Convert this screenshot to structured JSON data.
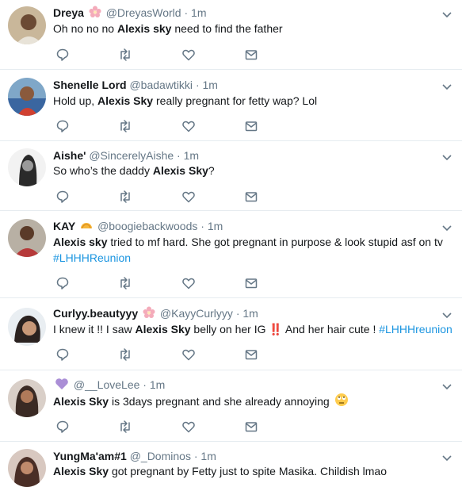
{
  "colors": {
    "accent": "#1b95e0",
    "muted": "#657786",
    "border": "#e6ecf0",
    "text": "#14171a"
  },
  "tweets": [
    {
      "name": "Dreya",
      "name_emoji": "cherry-blossom-icon",
      "handle": "@DreyasWorld",
      "time": "1m",
      "parts": [
        {
          "t": "Oh no no no "
        },
        {
          "t": "Alexis sky",
          "b": true
        },
        {
          "t": " need to find the father"
        }
      ]
    },
    {
      "name": "Shenelle Lord",
      "handle": "@badawtikki",
      "time": "1m",
      "parts": [
        {
          "t": "Hold up, "
        },
        {
          "t": "Alexis Sky",
          "b": true
        },
        {
          "t": " really pregnant for fetty wap? Lol"
        }
      ]
    },
    {
      "name": "Aishe'",
      "handle": "@SincerelyAishe",
      "time": "1m",
      "parts": [
        {
          "t": "So who’s the daddy "
        },
        {
          "t": "Alexis Sky",
          "b": true
        },
        {
          "t": "?"
        }
      ]
    },
    {
      "name": "KAY",
      "name_emoji": "taco-icon",
      "handle": "@boogiebackwoods",
      "time": "1m",
      "parts": [
        {
          "t": "Alexis sky",
          "b": true
        },
        {
          "t": " tried to mf hard. She got pregnant in purpose & look stupid asf on tv"
        },
        {
          "t": "\n"
        },
        {
          "t": "#LHHHReunion",
          "h": true
        }
      ]
    },
    {
      "name": "Curlyy.beautyyy",
      "name_emoji": "cherry-blossom-icon",
      "handle": "@KayyCurlyyy",
      "time": "1m",
      "parts": [
        {
          "t": "I knew it !! I saw "
        },
        {
          "t": "Alexis Sky",
          "b": true
        },
        {
          "t": " belly on her IG "
        },
        {
          "t": "‼️",
          "red": true
        },
        {
          "t": " And her hair cute ! "
        },
        {
          "t": "#LHHHreunion",
          "h": true
        }
      ]
    },
    {
      "name": "",
      "name_emoji": "purple-heart-icon",
      "handle": "@__LoveLee",
      "time": "1m",
      "parts": [
        {
          "t": "Alexis Sky",
          "b": true
        },
        {
          "t": " is 3days pregnant and she already annoying "
        },
        {
          "t": "🙄",
          "eye": true
        }
      ]
    },
    {
      "name": "YungMa'am#1",
      "handle": "@_Dominos",
      "time": "1m",
      "parts": [
        {
          "t": "Alexis Sky",
          "b": true
        },
        {
          "t": " got pregnant by Fetty just to spite Masika. Childish lmao"
        }
      ]
    }
  ]
}
